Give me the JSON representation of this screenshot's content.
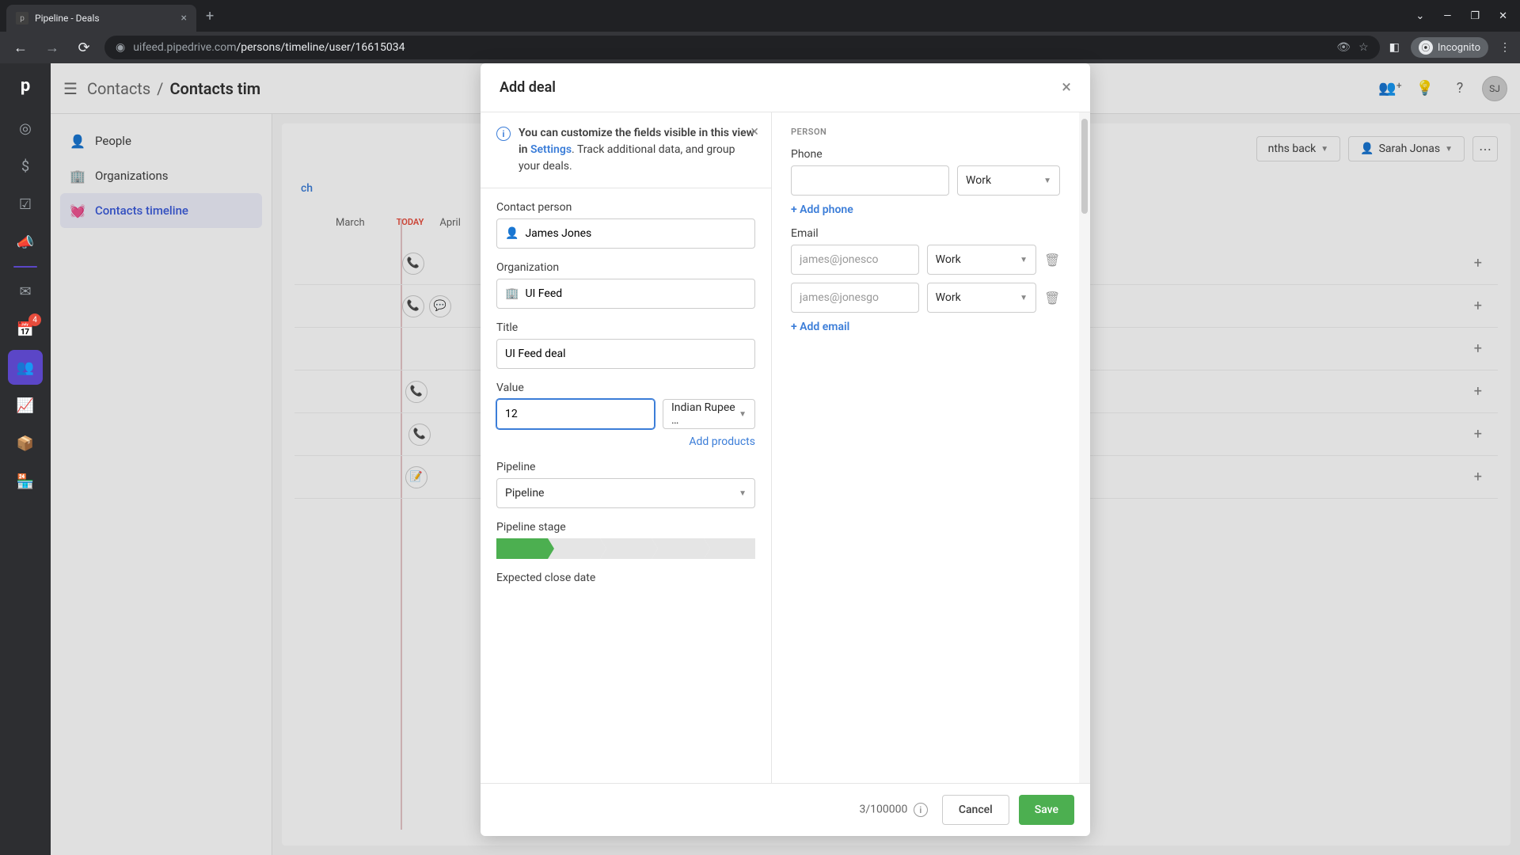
{
  "browser": {
    "tab_title": "Pipeline - Deals",
    "url_host": "uifeed.pipedrive.com",
    "url_path": "/persons/timeline/user/16615034",
    "incognito_label": "Incognito"
  },
  "topbar": {
    "breadcrumb_parent": "Contacts",
    "breadcrumb_current": "Contacts tim",
    "avatar_initials": "SJ"
  },
  "sidebar": {
    "items": [
      {
        "icon": "person",
        "label": "People"
      },
      {
        "icon": "building",
        "label": "Organizations"
      },
      {
        "icon": "heart",
        "label": "Contacts timeline"
      }
    ]
  },
  "timeline_toolbar": {
    "months_back_suffix": "nths back",
    "user_filter": "Sarah Jonas"
  },
  "timeline": {
    "link_partial": "ch",
    "months": [
      "March",
      "April"
    ],
    "today_label": "TODAY"
  },
  "rail": {
    "badge_count": "4"
  },
  "modal": {
    "title": "Add deal",
    "info_banner": {
      "prefix": "You can customize the fields visible in this view in ",
      "link": "Settings",
      "suffix": ". Track additional data, and group your deals."
    },
    "labels": {
      "contact_person": "Contact person",
      "organization": "Organization",
      "title": "Title",
      "value": "Value",
      "pipeline": "Pipeline",
      "pipeline_stage": "Pipeline stage",
      "expected_close_date": "Expected close date"
    },
    "values": {
      "contact_person": "James Jones",
      "organization": "UI Feed",
      "title": "UI Feed deal",
      "value_amount": "12",
      "currency": "Indian Rupee …",
      "pipeline": "Pipeline"
    },
    "links": {
      "add_products": "Add products"
    },
    "person": {
      "section_title": "PERSON",
      "phone_label": "Phone",
      "phone_type": "Work",
      "add_phone": "+ Add phone",
      "email_label": "Email",
      "emails": [
        {
          "placeholder": "james@jonesco",
          "type": "Work"
        },
        {
          "placeholder": "james@jonesgo",
          "type": "Work"
        }
      ],
      "add_email": "+ Add email"
    },
    "footer": {
      "counter": "3/100000",
      "cancel": "Cancel",
      "save": "Save"
    }
  }
}
